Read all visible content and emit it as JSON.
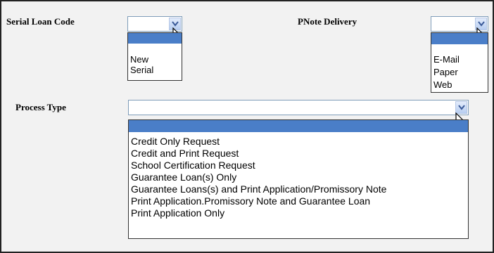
{
  "serial_loan": {
    "label": "Serial Loan Code",
    "options": [
      "",
      "New",
      "Serial"
    ]
  },
  "pnote": {
    "label": "PNote Delivery",
    "options": [
      "",
      "E-Mail",
      "Paper",
      "Web"
    ]
  },
  "process": {
    "label": "Process Type",
    "options": [
      "",
      "Credit Only Request",
      "Credit and Print Request",
      "School Certification Request",
      "Guarantee Loan(s) Only",
      "Guarantee Loans(s) and Print Application/Promissory Note",
      "Print Application.Promissory Note and Guarantee Loan",
      "Print Application Only"
    ]
  },
  "colors": {
    "highlight": "#4a7ec8",
    "background": "#f2f2f2"
  }
}
